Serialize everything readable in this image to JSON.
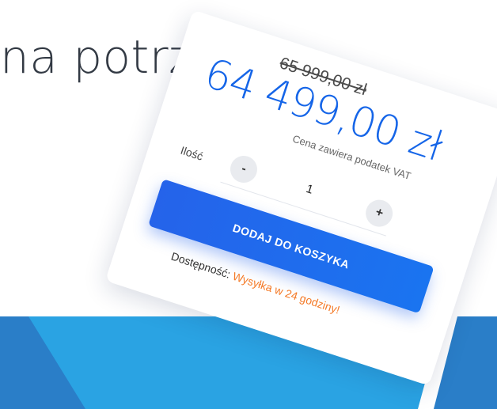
{
  "heading": "na potrzeby",
  "product": {
    "old_price": "65 999,00 zł",
    "price": "64 499,00 zł",
    "vat_note": "Cena zawiera podatek VAT"
  },
  "quantity": {
    "label": "Ilość",
    "minus_label": "-",
    "value": "1",
    "plus_label": "+"
  },
  "add_to_cart_label": "DODAJ DO KOSZYKA",
  "availability": {
    "label": "Dostępność:",
    "status": "Wysyłka w 24 godziny!"
  },
  "colors": {
    "price": "#1565e8",
    "button": "#2563ea",
    "availability_status": "#f47a27",
    "band_light": "#2aa3e3",
    "band_dark": "#2a7ec8"
  }
}
